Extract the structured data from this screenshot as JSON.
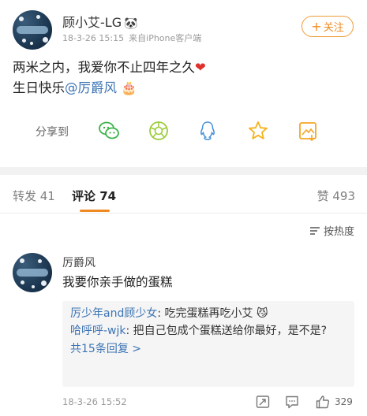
{
  "post": {
    "author": "顾小艾-LG",
    "author_emoji": "🐼",
    "time": "18-3-26 15:15",
    "source": "来自iPhone客户端",
    "follow_label": "关注",
    "line1": "两米之内，我爱你不止四年之久",
    "heart": "❤",
    "line2_prefix": "生日快乐",
    "mention": "@厉爵风",
    "cake": "🎂"
  },
  "share": {
    "label": "分享到",
    "icons": [
      "wechat-icon",
      "moments-icon",
      "qq-icon",
      "favorite-star-icon",
      "save-image-icon"
    ]
  },
  "tabs": {
    "reposts": "转发 41",
    "comments": "评论 74",
    "likes": "赞 493"
  },
  "sort": {
    "label": "按热度"
  },
  "comment": {
    "author": "厉爵风",
    "text": "我要你亲手做的蛋糕",
    "replies": [
      {
        "name": "厉少年and顾少女",
        "text": ": 吃完蛋糕再吃小艾",
        "emoji": "😼"
      },
      {
        "name": "哈呼呼-wjk",
        "text": ": 把自己包成个蛋糕送给你最好，是不是?"
      }
    ],
    "more_replies": "共15条回复 >",
    "time": "18-3-26 15:52",
    "like_count": "329"
  },
  "colors": {
    "accent": "#f08a20",
    "link": "#3d74b4",
    "heart": "#e0302d"
  }
}
